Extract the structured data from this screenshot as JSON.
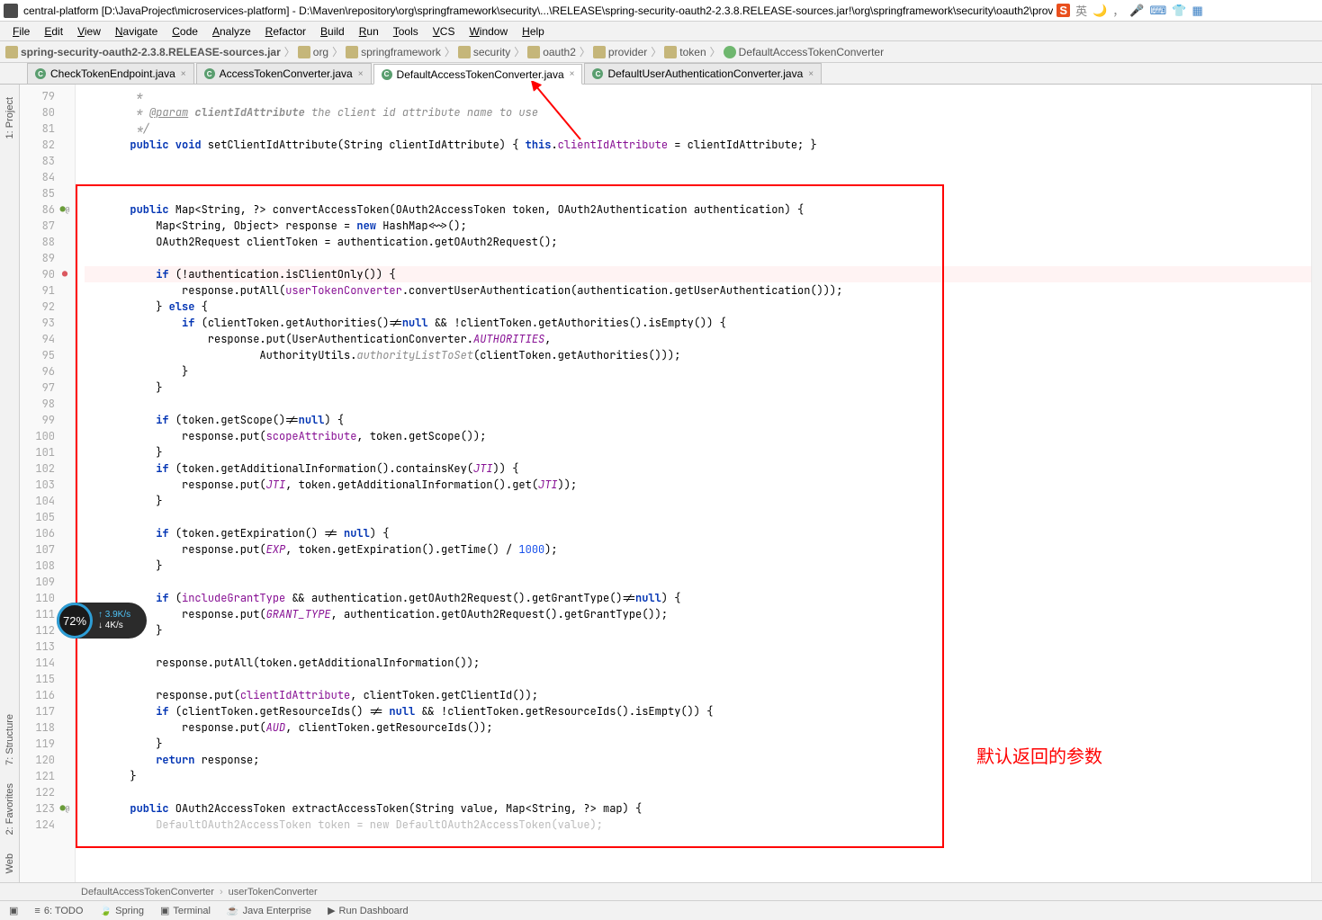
{
  "title": "central-platform [D:\\JavaProject\\microservices-platform] - D:\\Maven\\repository\\org\\springframework\\security\\...\\RELEASE\\spring-security-oauth2-2.3.8.RELEASE-sources.jar!\\org\\springframework\\security\\oauth2\\prov",
  "title_input_badge": "S",
  "title_lang": "英",
  "menu": [
    "File",
    "Edit",
    "View",
    "Navigate",
    "Code",
    "Analyze",
    "Refactor",
    "Build",
    "Run",
    "Tools",
    "VCS",
    "Window",
    "Help"
  ],
  "nav": {
    "root": "spring-security-oauth2-2.3.8.RELEASE-sources.jar",
    "path": [
      "org",
      "springframework",
      "security",
      "oauth2",
      "provider",
      "token"
    ],
    "file": "DefaultAccessTokenConverter"
  },
  "tabs": [
    {
      "label": "CheckTokenEndpoint.java",
      "active": false
    },
    {
      "label": "AccessTokenConverter.java",
      "active": false
    },
    {
      "label": "DefaultAccessTokenConverter.java",
      "active": true
    },
    {
      "label": "DefaultUserAuthenticationConverter.java",
      "active": false
    }
  ],
  "side_labels": {
    "project": "1: Project",
    "structure": "7: Structure",
    "favorites": "2: Favorites",
    "web": "Web"
  },
  "line_start": 79,
  "line_end": 124,
  "code": [
    {
      "n": 79,
      "h": "        <span class='com'>*</span>"
    },
    {
      "n": 80,
      "h": "        <span class='com'>* <span class='doctag'>@param</span> <b>clientIdAttribute</b> the client id attribute name to use</span>"
    },
    {
      "n": 81,
      "h": "        <span class='com'>*/</span>"
    },
    {
      "n": 82,
      "h": "       <span class='kw'>public void</span> setClientIdAttribute(String clientIdAttribute) { <span class='kw'>this</span>.<span class='fld'>clientIdAttribute</span> = clientIdAttribute; }"
    },
    {
      "n": 83,
      "h": ""
    },
    {
      "n": 84,
      "h": ""
    },
    {
      "n": 85,
      "h": ""
    },
    {
      "n": 86,
      "h": "       <span class='kw'>public</span> Map&lt;String, ?&gt; convertAccessToken(OAuth2AccessToken token, OAuth2Authentication authentication) {",
      "icon": "↑@"
    },
    {
      "n": 87,
      "h": "           Map&lt;String, Object&gt; response = <span class='kw'>new</span> HashMap&lt;~&gt;();"
    },
    {
      "n": 88,
      "h": "           OAuth2Request clientToken = authentication.getOAuth2Request();"
    },
    {
      "n": 89,
      "h": ""
    },
    {
      "n": 90,
      "h": "           <span class='kw'>if</span> (!authentication.isClientOnly()) {",
      "hl": true,
      "icon": "●"
    },
    {
      "n": 91,
      "h": "               response.putAll(<span class='fld'>userTokenConverter</span>.convertUserAuthentication(authentication.getUserAuthentication()));"
    },
    {
      "n": 92,
      "h": "           } <span class='kw'>else</span> {"
    },
    {
      "n": 93,
      "h": "               <span class='kw'>if</span> (clientToken.getAuthorities()!=<span class='kw'>null</span> &amp;&amp; !clientToken.getAuthorities().isEmpty()) {"
    },
    {
      "n": 94,
      "h": "                   response.put(UserAuthenticationConverter.<span class='fit'>AUTHORITIES</span>,"
    },
    {
      "n": 95,
      "h": "                           AuthorityUtils.<span class='com'>authorityListToSet</span>(clientToken.getAuthorities()));"
    },
    {
      "n": 96,
      "h": "               }"
    },
    {
      "n": 97,
      "h": "           }"
    },
    {
      "n": 98,
      "h": ""
    },
    {
      "n": 99,
      "h": "           <span class='kw'>if</span> (token.getScope()!=<span class='kw'>null</span>) {"
    },
    {
      "n": 100,
      "h": "               response.put(<span class='fld'>scopeAttribute</span>, token.getScope());"
    },
    {
      "n": 101,
      "h": "           }"
    },
    {
      "n": 102,
      "h": "           <span class='kw'>if</span> (token.getAdditionalInformation().containsKey(<span class='fit'>JTI</span>)) {"
    },
    {
      "n": 103,
      "h": "               response.put(<span class='fit'>JTI</span>, token.getAdditionalInformation().get(<span class='fit'>JTI</span>));"
    },
    {
      "n": 104,
      "h": "           }"
    },
    {
      "n": 105,
      "h": ""
    },
    {
      "n": 106,
      "h": "           <span class='kw'>if</span> (token.getExpiration() != <span class='kw'>null</span>) {"
    },
    {
      "n": 107,
      "h": "               response.put(<span class='fit'>EXP</span>, token.getExpiration().getTime() / <span class='num'>1000</span>);"
    },
    {
      "n": 108,
      "h": "           }"
    },
    {
      "n": 109,
      "h": ""
    },
    {
      "n": 110,
      "h": "           <span class='kw'>if</span> (<span class='fld'>includeGrantType</span> &amp;&amp; authentication.getOAuth2Request().getGrantType()!=<span class='kw'>null</span>) {"
    },
    {
      "n": 111,
      "h": "               response.put(<span class='fit'>GRANT_TYPE</span>, authentication.getOAuth2Request().getGrantType());"
    },
    {
      "n": 112,
      "h": "           }"
    },
    {
      "n": 113,
      "h": ""
    },
    {
      "n": 114,
      "h": "           response.putAll(token.getAdditionalInformation());"
    },
    {
      "n": 115,
      "h": ""
    },
    {
      "n": 116,
      "h": "           response.put(<span class='fld'>clientIdAttribute</span>, clientToken.getClientId());"
    },
    {
      "n": 117,
      "h": "           <span class='kw'>if</span> (clientToken.getResourceIds() != <span class='kw'>null</span> &amp;&amp; !clientToken.getResourceIds().isEmpty()) {"
    },
    {
      "n": 118,
      "h": "               response.put(<span class='fit'>AUD</span>, clientToken.getResourceIds());"
    },
    {
      "n": 119,
      "h": "           }"
    },
    {
      "n": 120,
      "h": "           <span class='kw'>return</span> response;"
    },
    {
      "n": 121,
      "h": "       }"
    },
    {
      "n": 122,
      "h": ""
    },
    {
      "n": 123,
      "h": "       <span class='kw'>public</span> OAuth2AccessToken extractAccessToken(String value, Map&lt;String, ?&gt; map) {",
      "icon": "↑@"
    },
    {
      "n": 124,
      "h": "           <span style='color:#bbb'>DefaultOAuth2AccessToken token = new DefaultOAuth2AccessToken(value);</span>"
    }
  ],
  "breadcrumb2": [
    "DefaultAccessTokenConverter",
    "userTokenConverter"
  ],
  "statusbar": [
    {
      "icon": "≡",
      "label": "6: TODO"
    },
    {
      "icon": "🍃",
      "label": "Spring"
    },
    {
      "icon": "▣",
      "label": "Terminal"
    },
    {
      "icon": "☕",
      "label": "Java Enterprise"
    },
    {
      "icon": "▶",
      "label": "Run Dashboard"
    }
  ],
  "annotation": {
    "text": "默认返回的参数"
  },
  "speed": {
    "pct": "72%",
    "up": "3.9K/s",
    "down": "4K/s"
  }
}
